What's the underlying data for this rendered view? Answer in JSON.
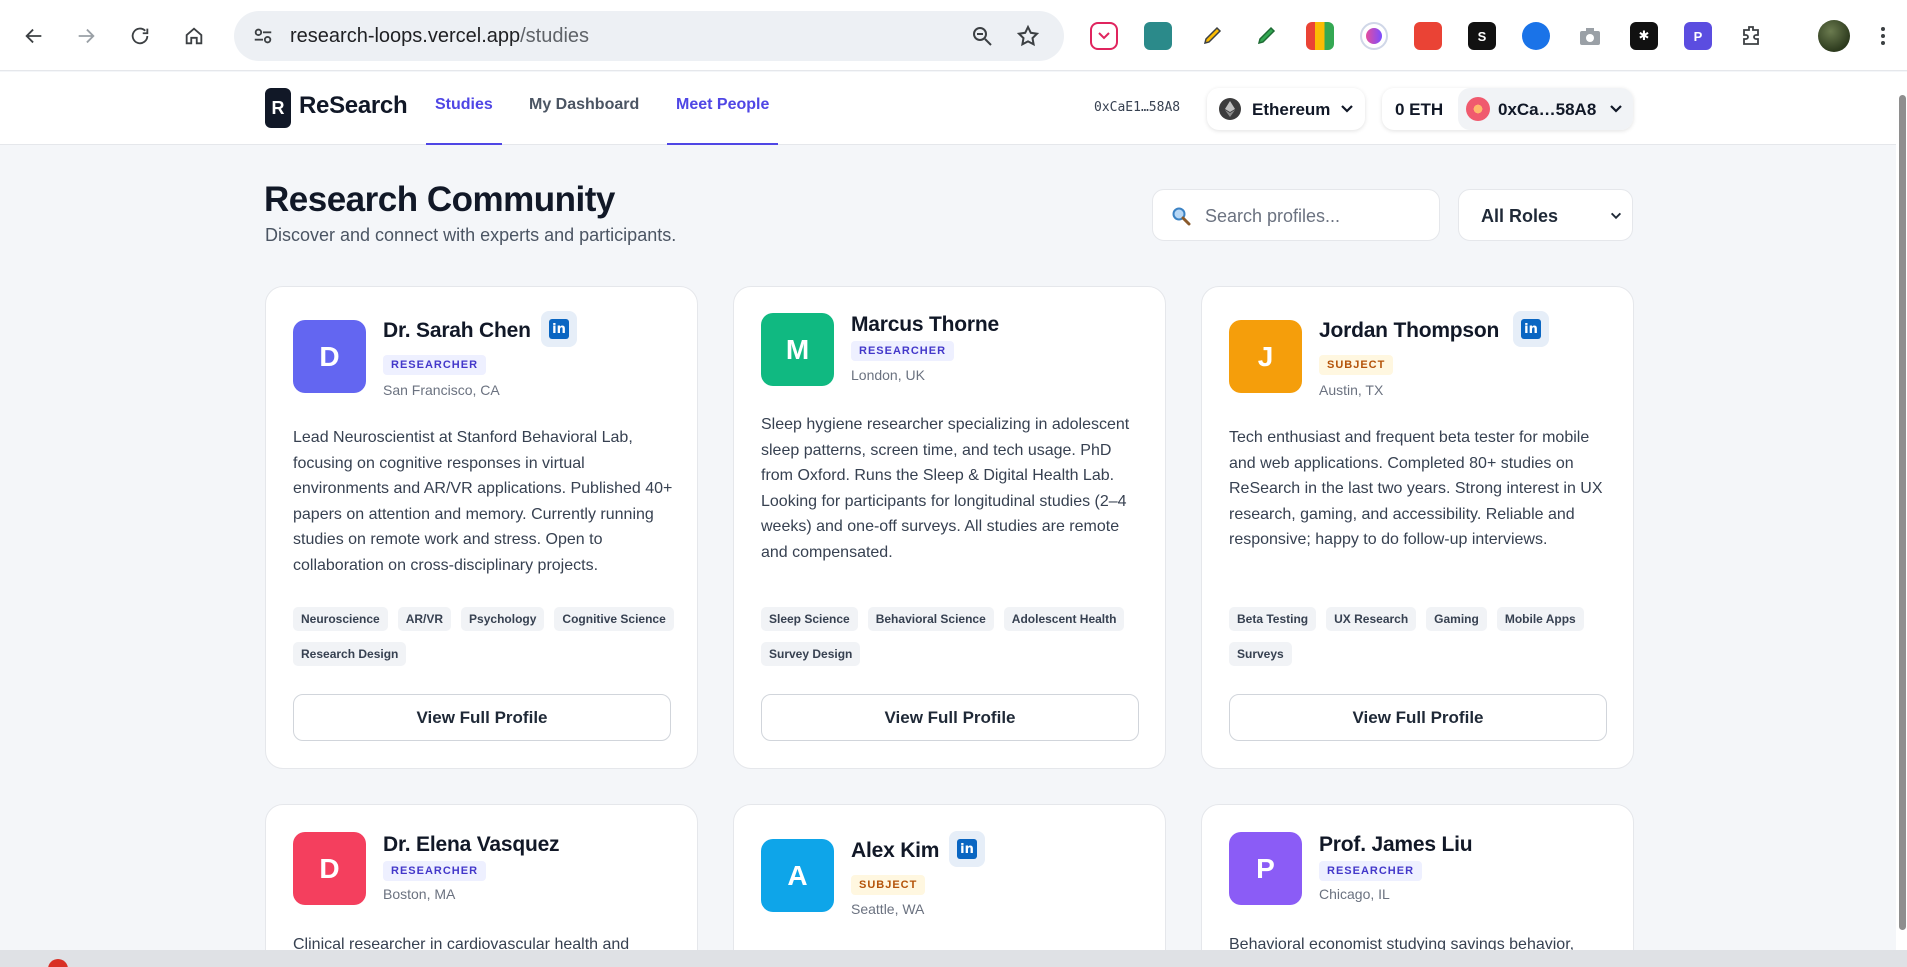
{
  "browser": {
    "url_host": "research-loops.vercel.app",
    "url_path": "/studies"
  },
  "app": {
    "logo_letter": "R",
    "logo_text": "ReSearch",
    "nav": [
      {
        "label": "Studies"
      },
      {
        "label": "My Dashboard"
      },
      {
        "label": "Meet People"
      }
    ],
    "wallet_short": "0xCaE1…58A8",
    "chain": "Ethereum",
    "balance": "0 ETH",
    "account": "0xCa…58A8"
  },
  "page": {
    "title": "Research Community",
    "subtitle": "Discover and connect with experts and participants.",
    "search_placeholder": "Search profiles...",
    "role_filter": "All Roles"
  },
  "profiles": [
    {
      "initial": "D",
      "name": "Dr. Sarah Chen",
      "role": "RESEARCHER",
      "location": "San Francisco, CA",
      "bio": "Lead Neuroscientist at Stanford Behavioral Lab, focusing on cognitive responses in virtual environments and AR/VR applications. Published 40+ papers on attention and memory. Currently running studies on remote work and stress. Open to collaboration on cross-disciplinary projects.",
      "tags": [
        "Neuroscience",
        "AR/VR",
        "Psychology",
        "Cognitive Science",
        "Research Design"
      ],
      "button": "View Full Profile",
      "avatar_color": "#6366f1",
      "linkedin": "in"
    },
    {
      "initial": "M",
      "name": "Marcus Thorne",
      "role": "RESEARCHER",
      "location": "London, UK",
      "bio": "Sleep hygiene researcher specializing in adolescent sleep patterns, screen time, and tech usage. PhD from Oxford. Runs the Sleep & Digital Health Lab. Looking for participants for longitudinal studies (2–4 weeks) and one-off surveys. All studies are remote and compensated.",
      "tags": [
        "Sleep Science",
        "Behavioral Science",
        "Adolescent Health",
        "Survey Design"
      ],
      "button": "View Full Profile",
      "avatar_color": "#10b981"
    },
    {
      "initial": "J",
      "name": "Jordan Thompson",
      "role": "SUBJECT",
      "location": "Austin, TX",
      "bio": "Tech enthusiast and frequent beta tester for mobile and web applications. Completed 80+ studies on ReSearch in the last two years. Strong interest in UX research, gaming, and accessibility. Reliable and responsive; happy to do follow-up interviews.",
      "tags": [
        "Beta Testing",
        "UX Research",
        "Gaming",
        "Mobile Apps",
        "Surveys"
      ],
      "button": "View Full Profile",
      "avatar_color": "#f59e0b",
      "linkedin": "in"
    },
    {
      "initial": "D",
      "name": "Dr. Elena Vasquez",
      "role": "RESEARCHER",
      "location": "Boston, MA",
      "bio": "Clinical researcher in cardiovascular health and",
      "avatar_color": "#f43f5e"
    },
    {
      "initial": "A",
      "name": "Alex Kim",
      "role": "SUBJECT",
      "location": "Seattle, WA",
      "avatar_color": "#0ea5e9",
      "linkedin": "in"
    },
    {
      "initial": "P",
      "name": "Prof. James Liu",
      "role": "RESEARCHER",
      "location": "Chicago, IL",
      "bio": "Behavioral economist studying savings behavior,",
      "avatar_color": "#8b5cf6"
    }
  ],
  "colors": {
    "accent": "#4f46e5",
    "researcher_badge": "#4338ca",
    "subject_badge": "#b45309"
  }
}
